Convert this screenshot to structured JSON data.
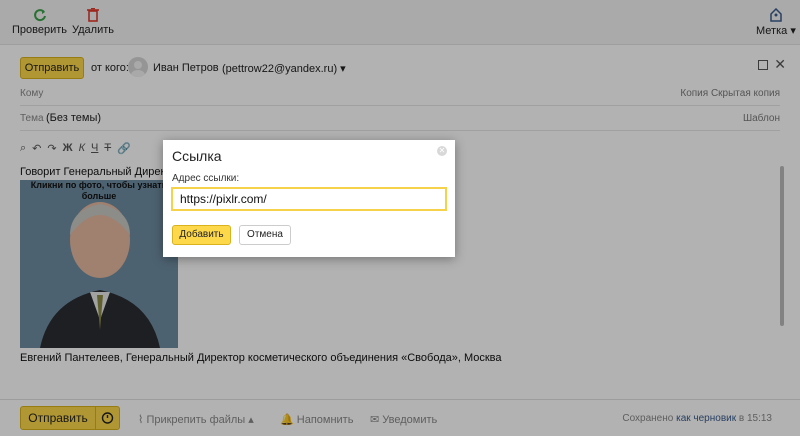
{
  "toolbar": {
    "check_label": "Проверить",
    "delete_label": "Удалить",
    "tag_label": "Метка"
  },
  "compose": {
    "send_label": "Отправить",
    "from_label": "от кого:",
    "from_name": "Иван Петров",
    "from_email": "(pettrow22@yandex.ru)",
    "to_label": "Кому",
    "cc_links": "Копия  Скрытая копия",
    "subject_label": "Тема",
    "subject_value": "(Без темы)",
    "template_link": "Шаблон",
    "body_line1": "Говорит Генеральный Директор",
    "photo_caption": "Кликни по фото, чтобы узнать больше",
    "body_line2": "Евгений Пантелеев, Генеральный Директор косметического объединения «Свобода», Москва"
  },
  "bottom": {
    "send_label": "Отправить",
    "attach_label": "Прикрепить файлы",
    "remind_label": "Напомнить",
    "notify_label": "Уведомить",
    "saved_prefix": "Сохранено",
    "saved_link": "как черновик",
    "saved_suffix": "в 15:13"
  },
  "dialog": {
    "title": "Ссылка",
    "address_label": "Адрес ссылки:",
    "address_value": "https://pixlr.com/",
    "add_label": "Добавить",
    "cancel_label": "Отмена"
  },
  "colors": {
    "accent": "#fcd84a",
    "overlay": "rgba(0,0,0,0.3)"
  },
  "icons": [
    "refresh-icon",
    "trash-icon",
    "tag-icon",
    "close-icon",
    "paperclip-icon",
    "bell-icon",
    "mail-icon",
    "timer-icon"
  ]
}
